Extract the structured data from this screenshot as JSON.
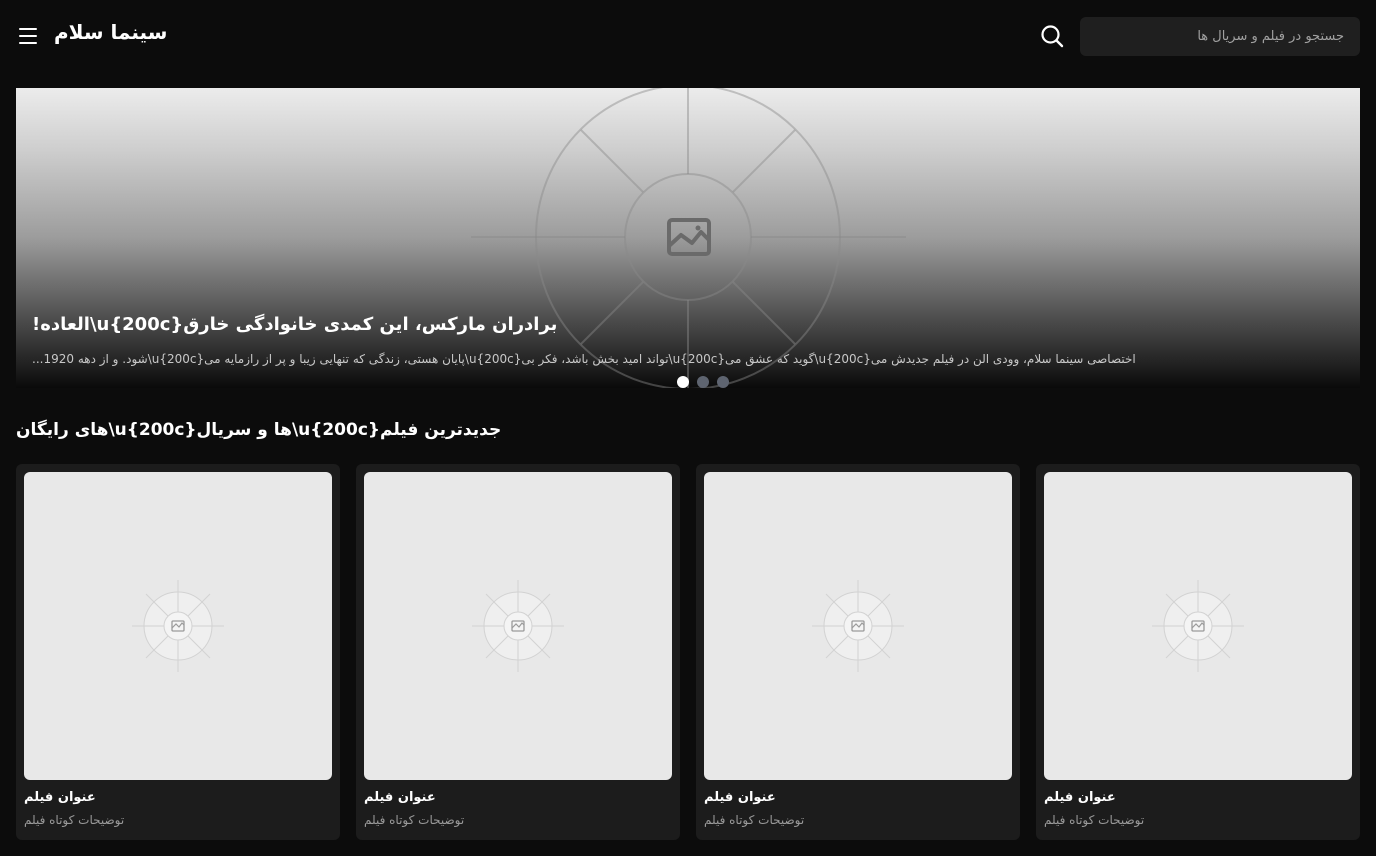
{
  "header": {
    "brand": "سینما سلام",
    "search_placeholder": "جستجو در فیلم و سریال ها",
    "search_icon": "search-icon",
    "menu_icon": "hamburger-menu-icon"
  },
  "hero": {
    "title": "!العاده‌\\u{200c}برادران مارکس، این کمدی خانوادگی خارق",
    "description": "...شود. و از دهه 1920\\u{200c}پایان هستی، زندگی که تنهایی زیبا و پر از رازمایه می\\u{200c}تواند امید بخش باشد، فکر بی\\u{200c}گوید که عشق می\\u{200c}اختصاصی سینما سلام، وودی الن در فیلم جدیدش می",
    "slides": 3,
    "active_slide": 1,
    "image_icon": "image-placeholder-icon"
  },
  "section": {
    "title": "های رایگان\\u{200c}ها و سریال\\u{200c}جدیدترین فیلم"
  },
  "cards": [
    {
      "title": "عنوان فیلم",
      "desc": "توضیحات کوتاه فیلم"
    },
    {
      "title": "عنوان فیلم",
      "desc": "توضیحات کوتاه فیلم"
    },
    {
      "title": "عنوان فیلم",
      "desc": "توضیحات کوتاه فیلم"
    },
    {
      "title": "عنوان فیلم",
      "desc": "توضیحات کوتاه فیلم"
    }
  ],
  "colors": {
    "background": "#0c0c0c",
    "card": "#1c1c1c",
    "search_bg": "#1f1f1f",
    "dot_active": "#ffffff",
    "dot_inactive": "#5e6470"
  }
}
